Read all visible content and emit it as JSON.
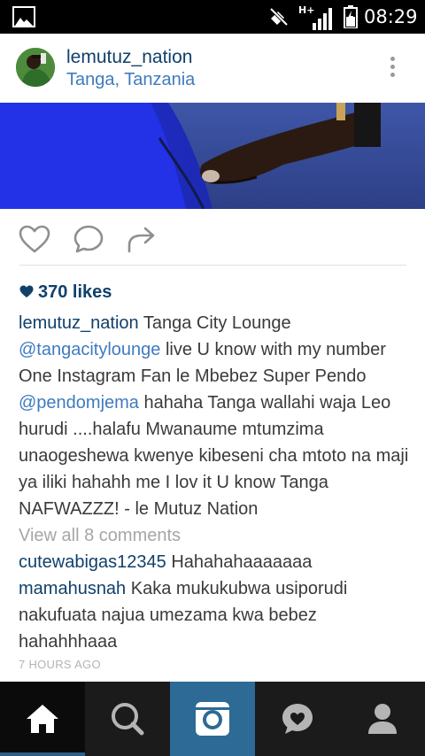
{
  "status_bar": {
    "network_label": "H+",
    "time": "08:29",
    "icons": [
      "gallery-icon",
      "mute-icon",
      "signal-icon",
      "battery-icon"
    ]
  },
  "post": {
    "username": "lemutuz_nation",
    "location": "Tanga, Tanzania",
    "likes": "370 likes",
    "caption": {
      "username": "lemutuz_nation",
      "text_1": " Tanga City Lounge ",
      "mention_1": "@tangacitylounge",
      "text_2": " live U know with my number One Instagram Fan le Mbebez Super Pendo ",
      "mention_2": "@pendomjema",
      "text_3": " hahaha Tanga wallahi waja Leo hurudi ....halafu Mwanaume mtumzima unaogeshewa kwenye kibeseni cha mtoto na maji ya iliki hahahh me I lov it U know Tanga NAFWAZZZ! - le Mutuz Nation"
    },
    "view_all_comments": "View all 8 comments",
    "comments": [
      {
        "username": "cutewabigas12345",
        "text": " Hahahahaaaaaaa"
      },
      {
        "username": "mamahusnah",
        "text": " Kaka mukukubwa  usiporudi nakufuata najua umezama kwa bebez hahahhhaaa"
      }
    ],
    "time_ago": "7 HOURS AGO"
  },
  "colors": {
    "username": "#10406b",
    "link": "#3f7bbf",
    "muted": "#a6a6a6",
    "nav_background": "#1b1b1b",
    "nav_camera": "#2d6a96"
  },
  "bottom_nav": [
    "home-icon",
    "search-icon",
    "camera-icon",
    "activity-icon",
    "profile-icon"
  ]
}
